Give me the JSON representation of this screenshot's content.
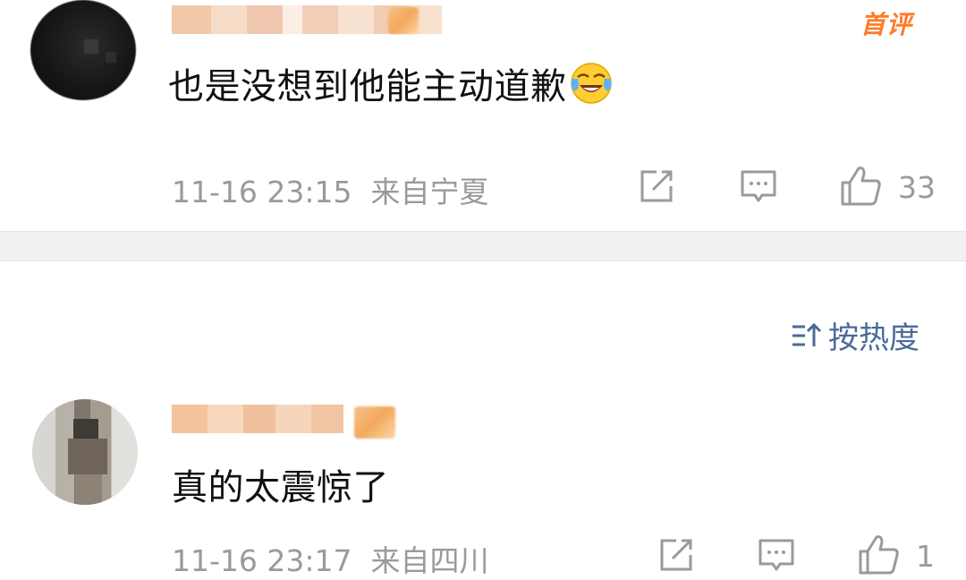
{
  "comments": [
    {
      "text": "也是没想到他能主动道歉",
      "emoji": "laughing-crying-emoji",
      "tag": "首评",
      "time": "11-16 23:15",
      "location": "来自宁夏",
      "likes": "33"
    },
    {
      "text": "真的太震惊了",
      "time": "11-16 23:17",
      "location": "来自四川",
      "likes": "1"
    }
  ],
  "sort": {
    "label": "按热度",
    "icon": "sort-icon"
  },
  "colors": {
    "accent": "#ff7a2a",
    "meta": "#9a9a9a",
    "link": "#4a6a9a"
  }
}
